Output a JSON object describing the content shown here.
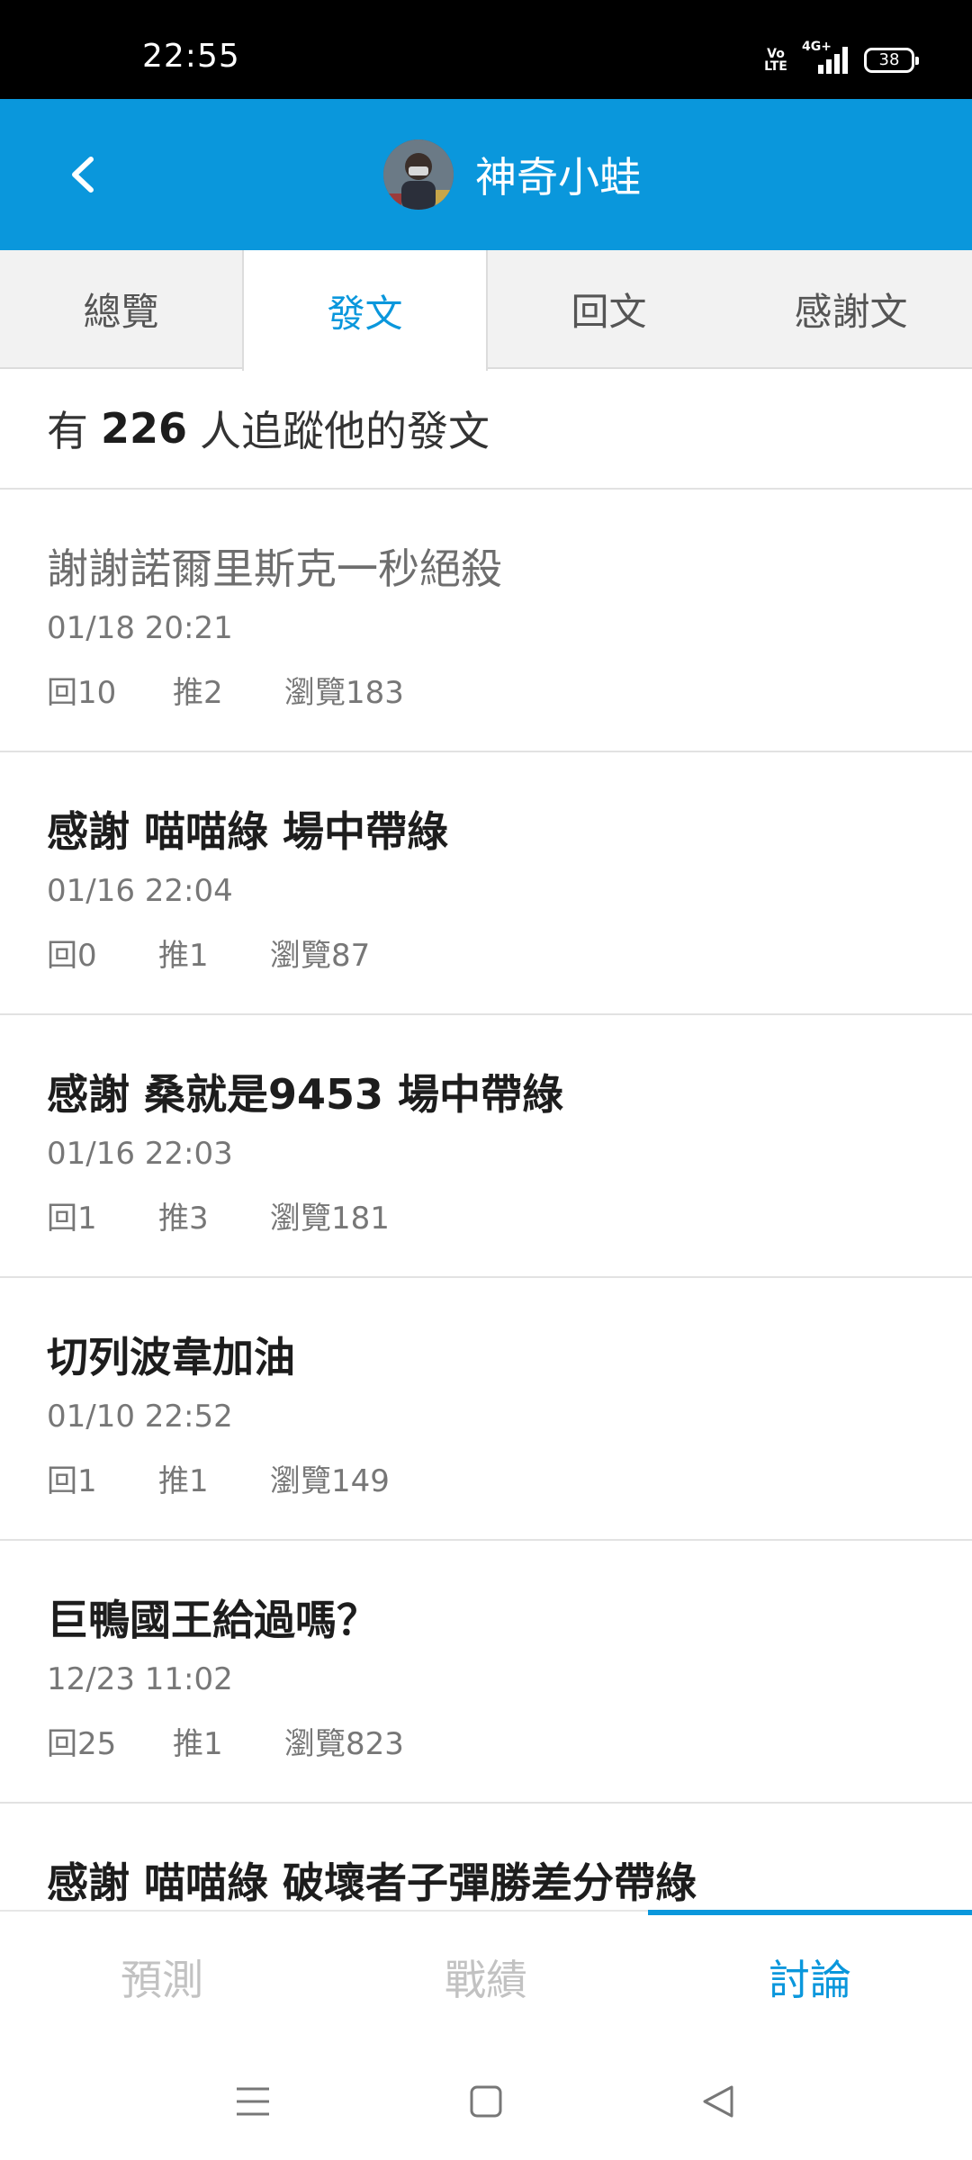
{
  "status_bar": {
    "time": "22:55",
    "volte": "Vo\nLTE",
    "network": "4G+",
    "battery": "38"
  },
  "header": {
    "title": "神奇小蛙",
    "accent_color": "#0a97dc",
    "back_icon": "chevron-left-icon"
  },
  "tabs": [
    {
      "label": "總覽",
      "active": false
    },
    {
      "label": "發文",
      "active": true
    },
    {
      "label": "回文",
      "active": false
    },
    {
      "label": "感謝文",
      "active": false
    }
  ],
  "followers": {
    "prefix": "有",
    "count": "226",
    "suffix": "人追蹤他的發文"
  },
  "posts": [
    {
      "title": "謝謝諾爾里斯克一秒絕殺",
      "read": true,
      "date": "01/18 20:21",
      "replies": "回10",
      "pushes": "推2",
      "views": "瀏覽183"
    },
    {
      "title": "感謝 喵喵綠 場中帶綠",
      "read": false,
      "date": "01/16 22:04",
      "replies": "回0",
      "pushes": "推1",
      "views": "瀏覽87"
    },
    {
      "title": "感謝 桑就是9453 場中帶綠",
      "read": false,
      "date": "01/16 22:03",
      "replies": "回1",
      "pushes": "推3",
      "views": "瀏覽181"
    },
    {
      "title": "切列波韋加油",
      "read": false,
      "date": "01/10 22:52",
      "replies": "回1",
      "pushes": "推1",
      "views": "瀏覽149"
    },
    {
      "title": "巨鴨國王給過嗎？",
      "read": false,
      "date": "12/23 11:02",
      "replies": "回25",
      "pushes": "推1",
      "views": "瀏覽823"
    },
    {
      "title": "感謝 喵喵綠 破壞者子彈勝差分帶綠",
      "read": false,
      "date": "",
      "replies": "",
      "pushes": "",
      "views": ""
    }
  ],
  "bottom_nav": [
    {
      "label": "預測",
      "active": false
    },
    {
      "label": "戰績",
      "active": false
    },
    {
      "label": "討論",
      "active": true
    }
  ],
  "system_nav": {
    "menu_icon": "menu-icon",
    "home_icon": "home-square-icon",
    "back_icon": "back-triangle-icon"
  }
}
